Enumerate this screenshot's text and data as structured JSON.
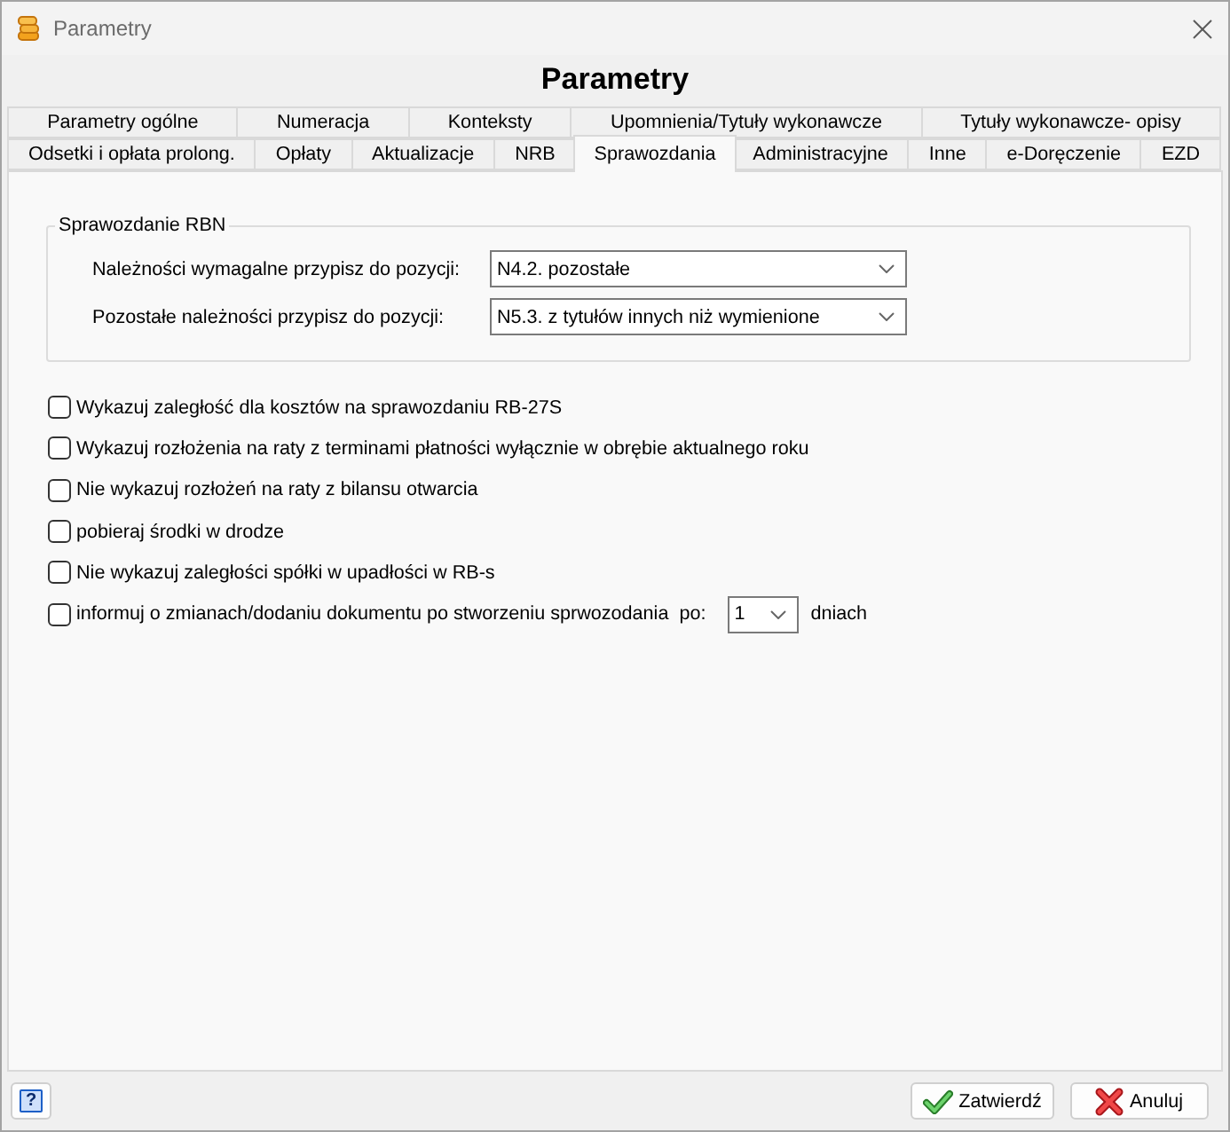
{
  "window": {
    "title": "Parametry",
    "heading": "Parametry"
  },
  "tab_rows": [
    [
      {
        "label": "Parametry ogólne",
        "selected": false
      },
      {
        "label": "Numeracja",
        "selected": false
      },
      {
        "label": "Konteksty",
        "selected": false
      },
      {
        "label": "Upomnienia/Tytuły wykonawcze",
        "selected": false
      },
      {
        "label": "Tytuły wykonawcze- opisy",
        "selected": false
      }
    ],
    [
      {
        "label": "Odsetki i opłata prolong.",
        "selected": false
      },
      {
        "label": "Opłaty",
        "selected": false
      },
      {
        "label": "Aktualizacje",
        "selected": false
      },
      {
        "label": "NRB",
        "selected": false
      },
      {
        "label": "Sprawozdania",
        "selected": true
      },
      {
        "label": "Administracyjne",
        "selected": false
      },
      {
        "label": "Inne",
        "selected": false
      },
      {
        "label": "e-Doręczenie",
        "selected": false
      },
      {
        "label": "EZD",
        "selected": false
      }
    ]
  ],
  "report_group": {
    "title": "Sprawozdanie RBN",
    "fields": [
      {
        "label": "Należności wymagalne przypisz do pozycji:",
        "value": "N4.2. pozostałe"
      },
      {
        "label": "Pozostałe należności przypisz do pozycji:",
        "value": "N5.3. z tytułów innych niż wymienione"
      }
    ]
  },
  "options": [
    {
      "kind": "plain",
      "label": "Wykazuj zaległość dla kosztów na sprawozdaniu RB-27S",
      "checked": false
    },
    {
      "kind": "plain",
      "label": "Wykazuj rozłożenia na raty z terminami płatności wyłącznie w obrębie aktualnego roku",
      "checked": false
    },
    {
      "kind": "plain",
      "label": "Nie wykazuj rozłożeń na raty z bilansu otwarcia",
      "checked": false
    },
    {
      "kind": "plain",
      "label": "pobieraj środki w drodze",
      "checked": false
    },
    {
      "kind": "plain",
      "label": "Nie wykazuj zaległości spółki w upadłości w RB-s",
      "checked": false
    },
    {
      "kind": "days",
      "label": "informuj o zmianach/dodaniu dokumentu po stworzeniu sprwozodania",
      "checked": false,
      "prefix": "po:",
      "value": "1",
      "suffix": "dniach"
    }
  ],
  "footer": {
    "help_button": "?",
    "buttons": [
      {
        "kind": "confirm",
        "label": "Zatwierdź"
      },
      {
        "kind": "cancel",
        "label": "Anuluj"
      }
    ]
  }
}
